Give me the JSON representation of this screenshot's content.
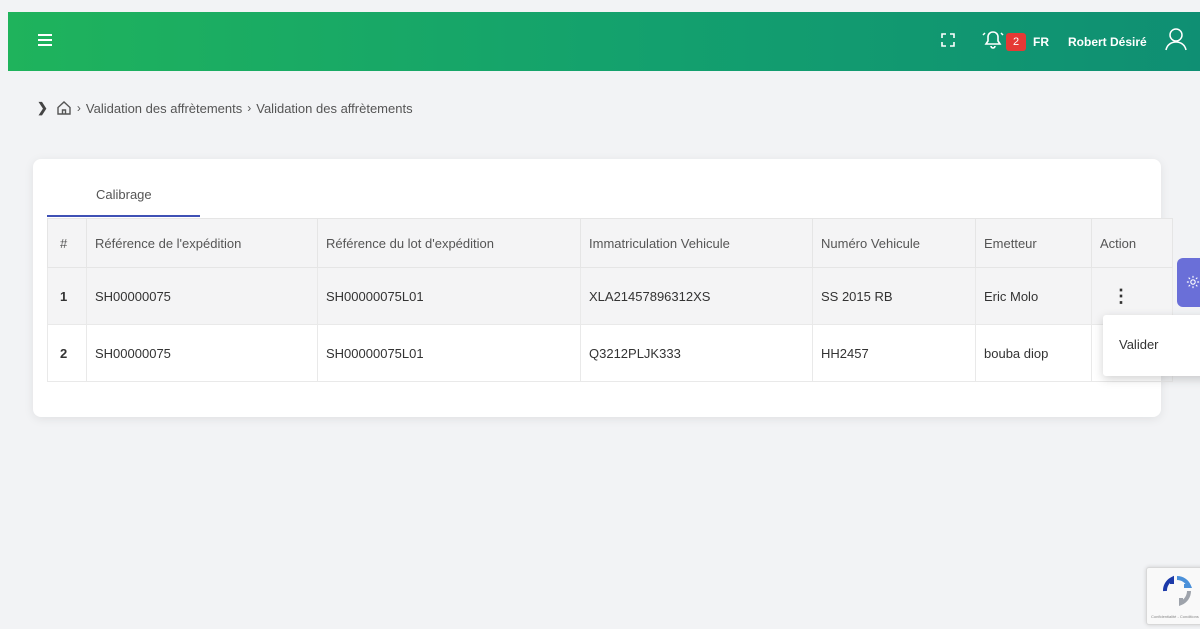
{
  "header": {
    "menu_icon": "hamburger-menu-icon",
    "fullscreen_icon": "fullscreen-icon",
    "notification_icon": "bell-icon",
    "notification_count": "2",
    "language": "FR",
    "user_name": "Robert Désiré",
    "user_icon": "user-icon",
    "colors": {
      "gradient_start": "#1fb35c",
      "gradient_end": "#0f8f73",
      "badge": "#e53935"
    }
  },
  "breadcrumb": {
    "home_icon": "home-icon",
    "items": [
      "Validation des affrètements",
      "Validation des affrètements"
    ]
  },
  "tabs": [
    {
      "label": "Calibrage",
      "active": true
    }
  ],
  "table": {
    "columns": [
      "#",
      "Référence de l'expédition",
      "Référence du lot d'expédition",
      "Immatriculation Vehicule",
      "Numéro Vehicule",
      "Emetteur",
      "Action"
    ],
    "rows": [
      {
        "num": "1",
        "ref_expedition": "SH00000075",
        "ref_lot": "SH00000075L01",
        "immatriculation": "XLA21457896312XS",
        "numero": "SS 2015 RB",
        "emetteur": "Eric Molo"
      },
      {
        "num": "2",
        "ref_expedition": "SH00000075",
        "ref_lot": "SH00000075L01",
        "immatriculation": "Q3212PLJK333",
        "numero": "HH2457",
        "emetteur": "bouba diop"
      }
    ]
  },
  "action_menu": {
    "items": [
      "Valider"
    ]
  },
  "settings_tab": {
    "icon": "gear-icon",
    "color": "#6a6fd8"
  },
  "recaptcha": {
    "icon": "recaptcha-icon",
    "label": "Confidentialité - Conditions"
  }
}
